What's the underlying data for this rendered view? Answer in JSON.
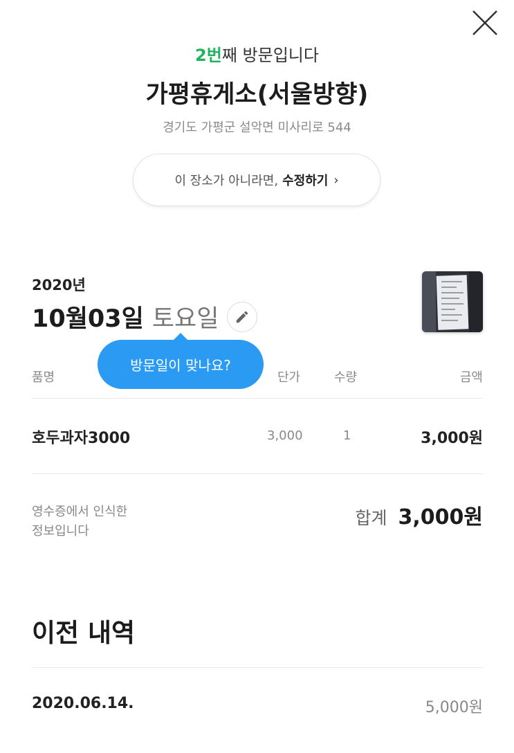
{
  "header": {
    "close_icon": "close-icon",
    "visit_count": "2번",
    "visit_suffix": "째 방문입니다",
    "place_name": "가평휴게소(서울방향)",
    "address": "경기도 가평군 설악면 미사리로 544"
  },
  "place_edit": {
    "prefix": "이 장소가 아니라면,",
    "action": "수정하기",
    "chevron": "›"
  },
  "visit": {
    "year": "2020년",
    "date": "10월03일",
    "weekday": "토요일",
    "edit_icon": "pencil-icon",
    "tooltip": "방문일이 맞나요?"
  },
  "table": {
    "headers": {
      "name": "품명",
      "unit_price": "단가",
      "qty": "수량",
      "amount": "금액"
    },
    "rows": [
      {
        "name": "호두과자3000",
        "unit_price": "3,000",
        "qty": "1",
        "amount": "3,000원"
      }
    ]
  },
  "summary": {
    "note_line1": "영수증에서 인식한",
    "note_line2": "정보입니다",
    "total_label": "합계",
    "total_value": "3,000원"
  },
  "history": {
    "title": "이전 내역",
    "items": [
      {
        "date": "2020.06.14.",
        "amount": "5,000원"
      }
    ]
  },
  "colors": {
    "accent_green": "#1fb35e",
    "tooltip_blue": "#2a9af3"
  }
}
